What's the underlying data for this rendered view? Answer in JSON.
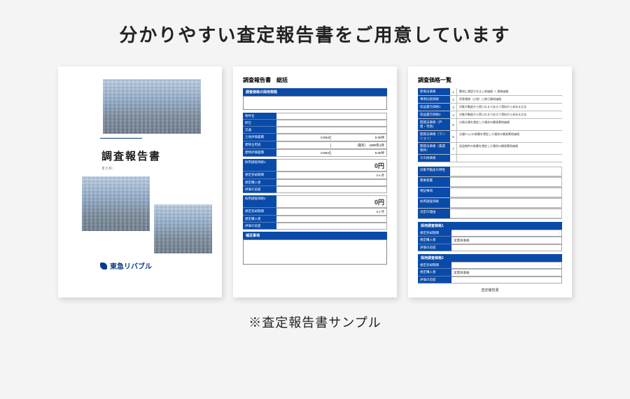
{
  "heading": "分かりやすい査定報告書をご用意しています",
  "caption": "※査定報告書サンプル",
  "brand": "東急リバブル",
  "doc1": {
    "title": "調査報告書",
    "subtitle": "まとめ："
  },
  "doc2": {
    "title": "調査報告書　総括",
    "section_header": "調査価格の採用根拠",
    "property_rows": [
      {
        "label": "物件名",
        "v": ""
      },
      {
        "label": "所在",
        "v": ""
      },
      {
        "label": "交通",
        "v": ""
      }
    ],
    "area_rows": [
      {
        "label": "土地評価面積",
        "v1": "0.00㎡",
        "v2": "0.00坪"
      },
      {
        "label": "建物主用途",
        "v1": "",
        "v2": "（築年）　1990年1月"
      },
      {
        "label": "建物評価面積",
        "v1": "0.00㎡",
        "v2": "0.00坪"
      }
    ],
    "block1": {
      "head": "採用調査価格1",
      "value": "0円",
      "rows": [
        {
          "label": "想定売却期間",
          "v": "0ヶ月"
        },
        {
          "label": "想定購入者",
          "v": ""
        },
        {
          "label": "評価の前提",
          "v": ""
        }
      ]
    },
    "block2": {
      "head": "採用調査価格2",
      "value": "0円",
      "rows": [
        {
          "label": "想定売却期間",
          "v": "0ヶ月"
        },
        {
          "label": "想定購入者",
          "v": ""
        },
        {
          "label": "評価の前提",
          "v": ""
        }
      ]
    },
    "notes_header": "補足事項"
  },
  "doc3": {
    "title": "調査価格一覧",
    "price_methods": [
      {
        "label": "原価法価格",
        "n": "1",
        "desc": "敷地に建設される上地価格 ＋ 建物価格"
      },
      {
        "label": "事例比較価格",
        "n": "2",
        "desc": "同等建物（土地）に取引事例価格"
      },
      {
        "label": "収益還元価格1",
        "n": "3",
        "desc": "対象不動産から得られるであろう賃料から求める方法"
      },
      {
        "label": "収益還元価格2",
        "n": "4",
        "desc": "対象不動産から得られるであろう賃料から求める方法"
      },
      {
        "label": "開発法価格（戸建・宅地）",
        "n": "5",
        "desc": "分割分譲を想定した場合の開発素地価格"
      },
      {
        "label": "開発法価格（マンション）",
        "n": "6",
        "desc": "分譲ﾏﾝｼｮﾝの新築を想定した場合の開発素地価格"
      },
      {
        "label": "開発法価格（賃貸物件）",
        "n": "7",
        "desc": "収益物件の新築を想定した場合の開発素地価格"
      },
      {
        "label": "その他価格",
        "n": "",
        "desc": ""
      }
    ],
    "char_rows": [
      {
        "label": "対象不動産の特性"
      },
      {
        "label": "需要者層"
      },
      {
        "label": "特記事項"
      },
      {
        "label": "採用調査価格"
      },
      {
        "label": "決定の理由"
      }
    ],
    "adopt1": {
      "head": "採用調査価格1",
      "rows": [
        {
          "label": "想定売却期間",
          "v": "-"
        },
        {
          "label": "想定購入者",
          "v": "実需系価格"
        },
        {
          "label": "評価の前提",
          "v": ""
        }
      ]
    },
    "adopt2": {
      "head": "採用調査価格2",
      "rows": [
        {
          "label": "想定売却期間",
          "v": "-"
        },
        {
          "label": "想定購入者",
          "v": "実需系価格"
        },
        {
          "label": "評価の前提",
          "v": ""
        }
      ]
    },
    "footer": "査定報告書"
  }
}
